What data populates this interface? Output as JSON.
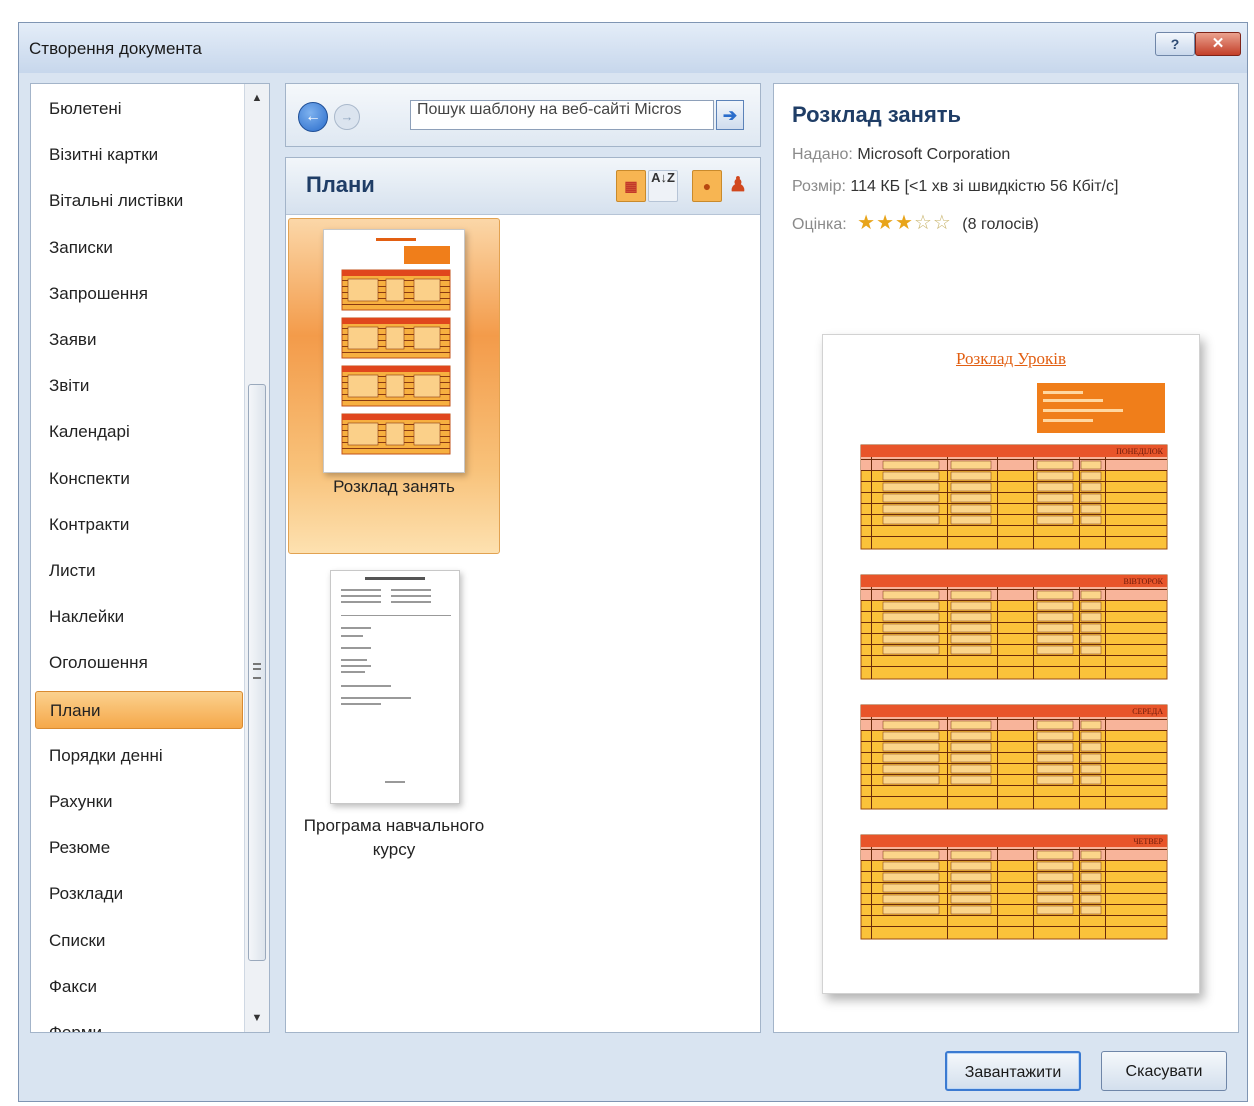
{
  "window": {
    "title": "Створення документа",
    "help_label": "?",
    "close_label": "✕"
  },
  "sidebar": {
    "items": [
      {
        "label": "Бюлетені"
      },
      {
        "label": "Візитні картки"
      },
      {
        "label": "Вітальні листівки"
      },
      {
        "label": "Записки"
      },
      {
        "label": "Запрошення"
      },
      {
        "label": "Заяви"
      },
      {
        "label": "Звіти"
      },
      {
        "label": "Календарі"
      },
      {
        "label": "Конспекти"
      },
      {
        "label": "Контракти"
      },
      {
        "label": "Листи"
      },
      {
        "label": "Наклейки"
      },
      {
        "label": "Оголошення"
      },
      {
        "label": "Плани",
        "selected": true
      },
      {
        "label": "Порядки денні"
      },
      {
        "label": "Рахунки"
      },
      {
        "label": "Резюме"
      },
      {
        "label": "Розклади"
      },
      {
        "label": "Списки"
      },
      {
        "label": "Факси"
      },
      {
        "label": "Форми"
      }
    ],
    "scroll_up_icon": "▲",
    "scroll_down_icon": "▼"
  },
  "nav": {
    "back_icon": "←",
    "forward_icon": "→",
    "search_value": "Пошук шаблону на веб-сайті Micros",
    "go_icon": "➔"
  },
  "gallery": {
    "title": "Плани",
    "icons": {
      "thumb": "▦",
      "sort": "A↓Z",
      "user": "●",
      "userx": "♟"
    },
    "templates": [
      {
        "label": "Розклад занять",
        "selected": true
      },
      {
        "label": "Програма навчального курсу"
      }
    ]
  },
  "preview": {
    "title": "Розклад занять",
    "provided_label": "Надано:",
    "provided_value": "Microsoft Corporation",
    "size_label": "Розмір:",
    "size_value": "114 КБ [<1 хв зі швидкістю 56 Кбіт/с]",
    "rating_label": "Оцінка:",
    "rating_value": 3,
    "rating_max": 5,
    "votes": "(8 голосів)",
    "page_title": "Розклад Уроків",
    "days": [
      "ПОНЕДІЛОК",
      "ВІВТОРОК",
      "СЕРЕДА",
      "ЧЕТВЕР"
    ]
  },
  "footer": {
    "ok_label": "Завантажити",
    "cancel_label": "Скасувати"
  },
  "colors": {
    "accent_orange": "#f39b4a",
    "title_blue": "#1f3d66",
    "schedule_red": "#e8552a",
    "schedule_yellow": "#fbc23a"
  }
}
